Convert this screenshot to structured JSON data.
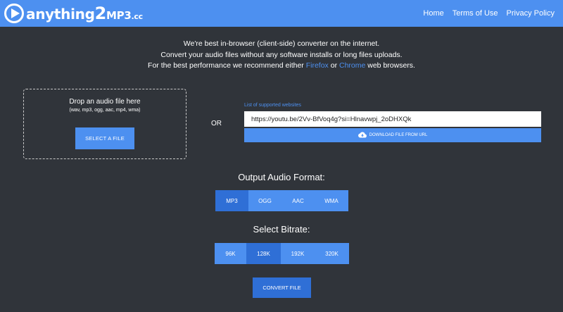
{
  "header": {
    "logo": {
      "text_main": "anything",
      "text_two": "2",
      "text_mp3": "MP3",
      "text_cc": ".cc"
    },
    "nav": [
      "Home",
      "Terms of Use",
      "Privacy Policy"
    ]
  },
  "intro": {
    "line1": "We're best in-browser (client-side) converter on the internet.",
    "line2": "Convert your audio files without any software installs or long files uploads.",
    "line3_before": "For the best performance we recommend either ",
    "firefox": "Firefox",
    "line3_or": " or ",
    "chrome": "Chrome",
    "line3_after": " web browsers."
  },
  "dropzone": {
    "title": "Drop an audio file here",
    "formats": "(wav, mp3, ogg, aac, mp4, wma)",
    "select_button": "SELECT A FILE"
  },
  "or_label": "OR",
  "url": {
    "supported_link": "List of supported websites",
    "value": "https://youtu.be/2Vv-BfVoq4g?si=Hlnavwpj_2oDHXQk",
    "download_button": "DOWNLOAD FILE FROM URL",
    "download_icon": "cloud-download-icon"
  },
  "format": {
    "title": "Output Audio Format:",
    "options": [
      "MP3",
      "OGG",
      "AAC",
      "WMA"
    ],
    "selected": "MP3"
  },
  "bitrate": {
    "title": "Select Bitrate:",
    "options": [
      "96K",
      "128K",
      "192K",
      "320K"
    ],
    "selected": "128K"
  },
  "convert_button": "CONVERT FILE",
  "colors": {
    "background": "#30343a",
    "accent": "#4d90f0",
    "accent_active": "#2f6fd6",
    "header": "#4d90f0"
  }
}
